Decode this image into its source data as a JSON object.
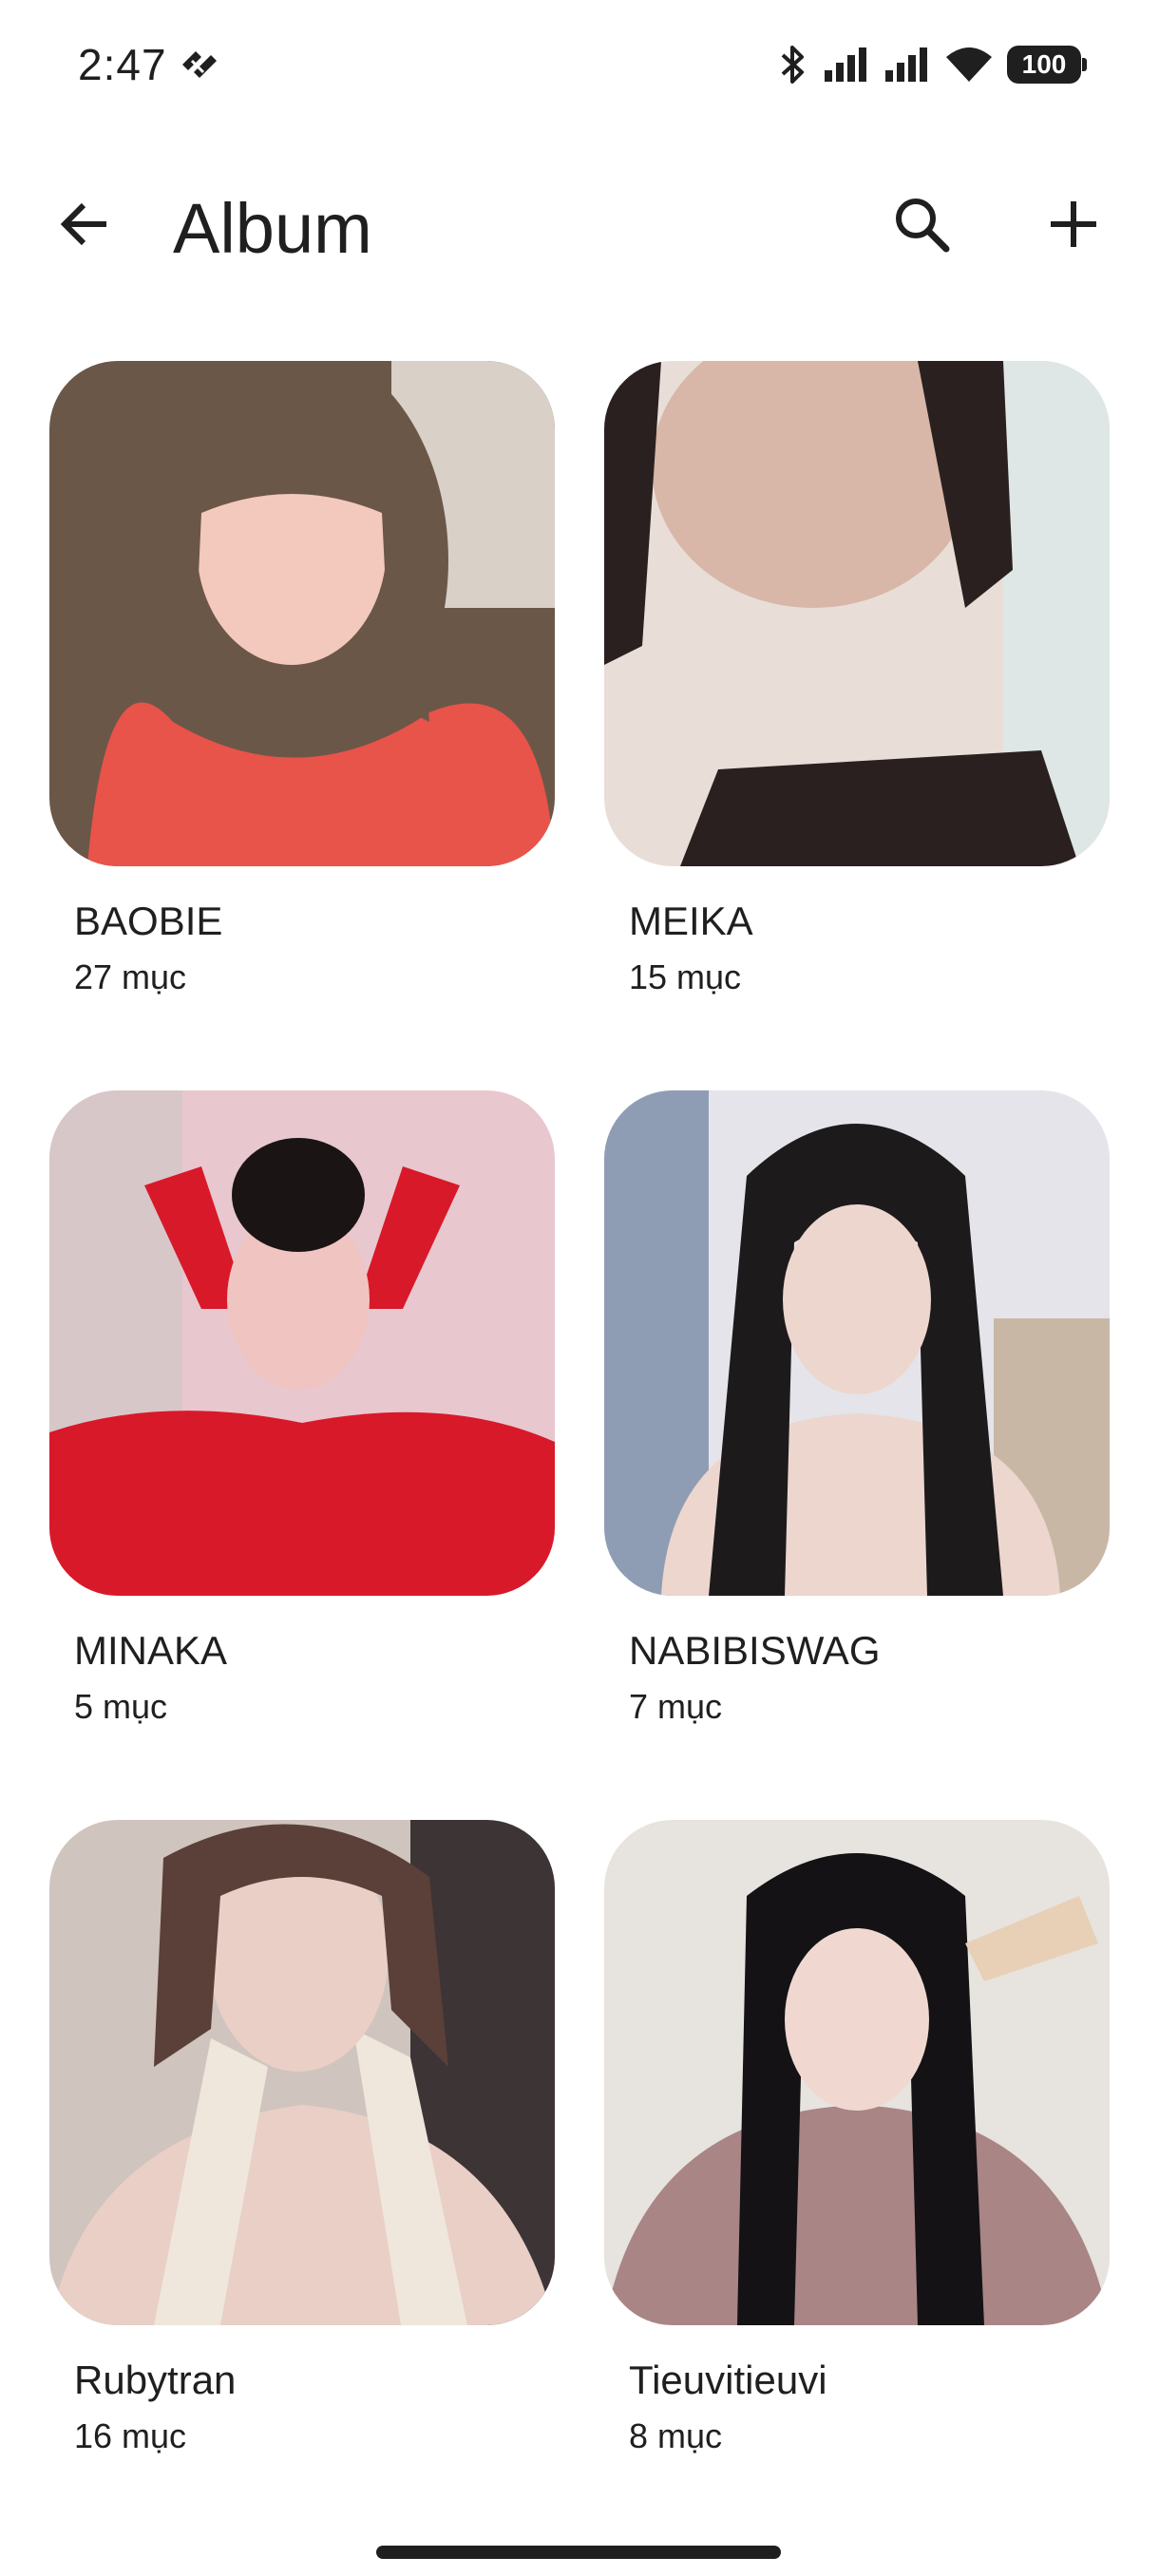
{
  "status_bar": {
    "time": "2:47",
    "battery": "100"
  },
  "app_bar": {
    "title": "Album",
    "back_icon": "arrow-back-icon",
    "search_icon": "search-icon",
    "add_icon": "plus-icon"
  },
  "albums": [
    {
      "name": "BAOBIE",
      "count": "27 mục",
      "thumb_colors": [
        "#e8534a",
        "#f2c9bc",
        "#6b5748"
      ]
    },
    {
      "name": "MEIKA",
      "count": "15 mục",
      "thumb_colors": [
        "#d8b7a8",
        "#e9ddd7",
        "#2a2020"
      ]
    },
    {
      "name": "MINAKA",
      "count": "5 mục",
      "thumb_colors": [
        "#d8192a",
        "#f0c4c0",
        "#1b1414"
      ]
    },
    {
      "name": "NABIBISWAG",
      "count": "7 mục",
      "thumb_colors": [
        "#c9c9cf",
        "#ecd6cd",
        "#1d1a1c"
      ]
    },
    {
      "name": "Rubytran",
      "count": "16 mục",
      "thumb_colors": [
        "#3d3436",
        "#e9cfc5",
        "#efe6dc"
      ]
    },
    {
      "name": "Tieuvitieuvi",
      "count": "8 mục",
      "thumb_colors": [
        "#e7e3df",
        "#a98585",
        "#141214"
      ]
    }
  ]
}
